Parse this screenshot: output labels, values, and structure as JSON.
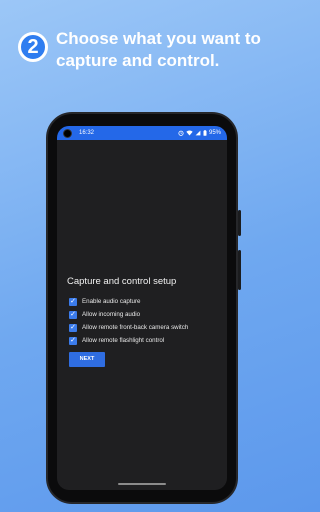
{
  "headline": {
    "step_number": "2",
    "text": "Choose what you want to capture and control."
  },
  "status_bar": {
    "time": "16:32",
    "battery": "95%"
  },
  "setup": {
    "title": "Capture and control setup",
    "options": [
      {
        "label": "Enable audio capture",
        "checked": true
      },
      {
        "label": "Allow incoming audio",
        "checked": true
      },
      {
        "label": "Allow remote front-back camera switch",
        "checked": true
      },
      {
        "label": "Allow remote flashlight control",
        "checked": true
      }
    ],
    "next_label": "NEXT"
  },
  "colors": {
    "accent": "#2f6de1",
    "status_bar": "#2468e8",
    "background_top": "#9cc7f7",
    "background_bottom": "#5c98ec"
  }
}
